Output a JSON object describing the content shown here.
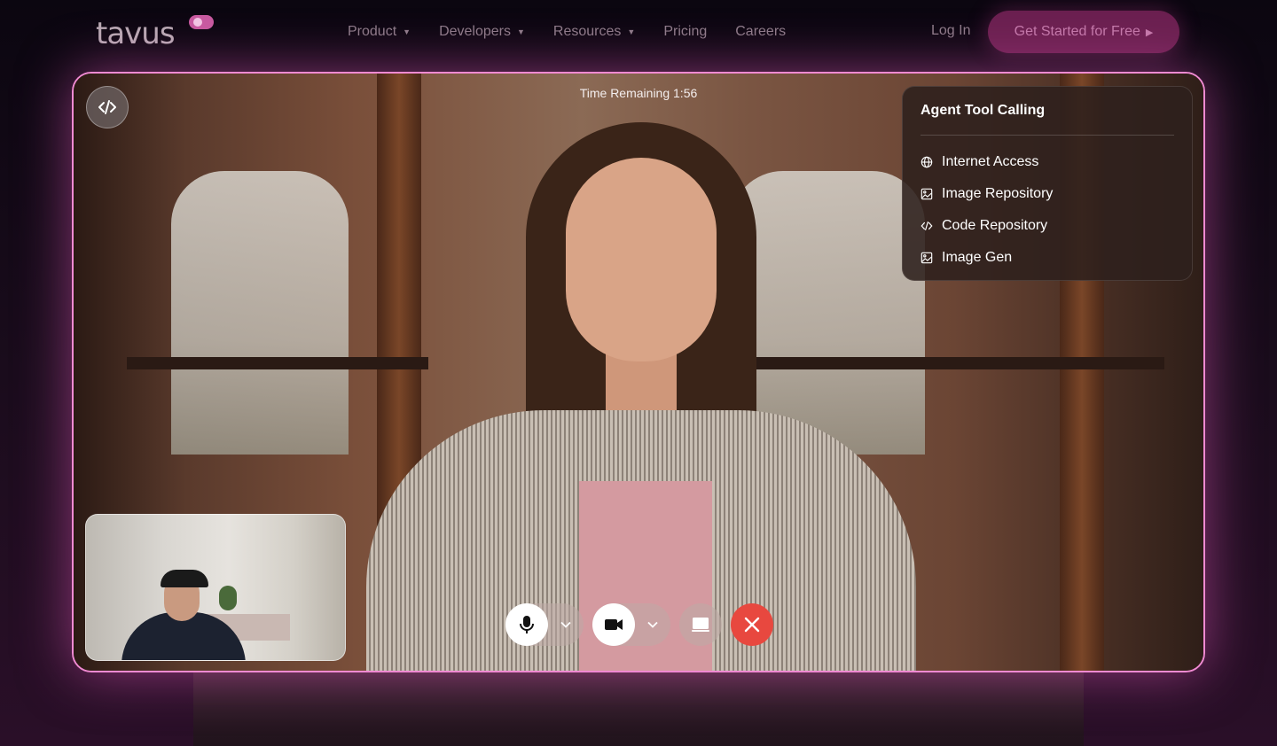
{
  "brand": {
    "logo_text": "tavus"
  },
  "nav": {
    "items": [
      {
        "label": "Product",
        "has_dropdown": true
      },
      {
        "label": "Developers",
        "has_dropdown": true
      },
      {
        "label": "Resources",
        "has_dropdown": true
      },
      {
        "label": "Pricing",
        "has_dropdown": false
      },
      {
        "label": "Careers",
        "has_dropdown": false
      }
    ],
    "login": "Log In",
    "cta": "Get Started for Free"
  },
  "call": {
    "timer": "Time Remaining 1:56",
    "panel": {
      "title": "Agent Tool Calling",
      "tools": [
        {
          "label": "Internet Access",
          "icon": "globe-icon"
        },
        {
          "label": "Image Repository",
          "icon": "image-icon"
        },
        {
          "label": "Code Repository",
          "icon": "code-icon"
        },
        {
          "label": "Image Gen",
          "icon": "image-icon"
        }
      ]
    },
    "controls": [
      "microphone-icon",
      "camera-icon",
      "screen-share-icon",
      "end-call-icon"
    ]
  },
  "colors": {
    "accent_border": "#f08ad2",
    "cta_bg": "#6b2050",
    "end_call": "#e8483f"
  }
}
